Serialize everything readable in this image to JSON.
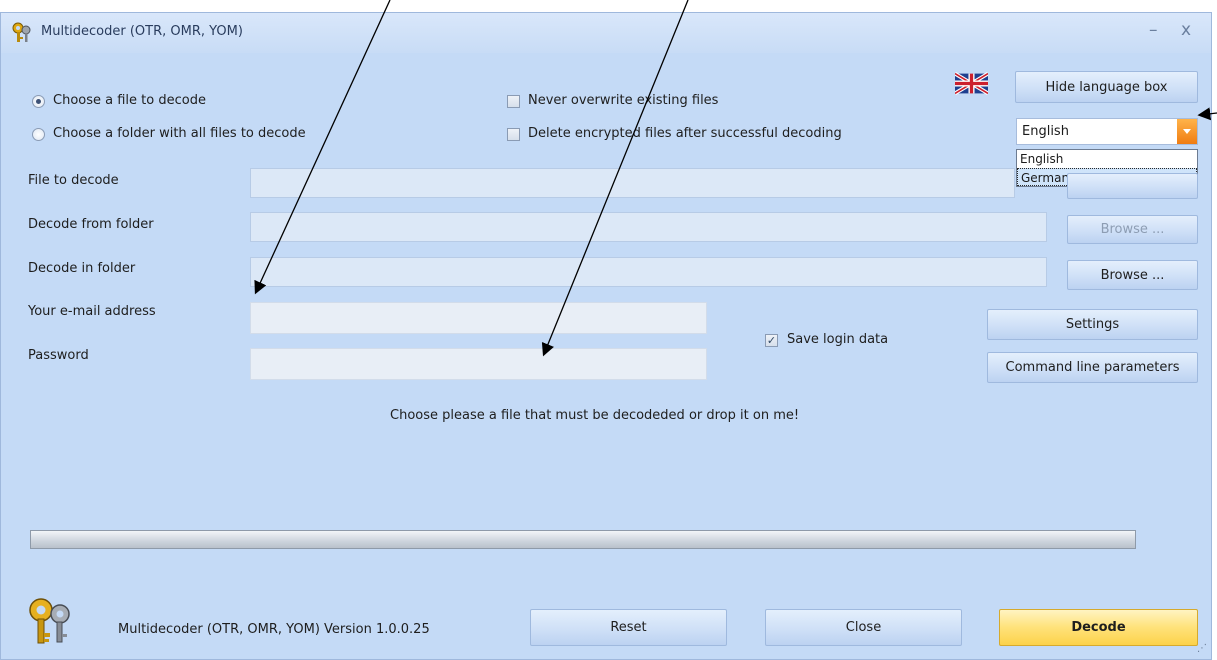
{
  "window": {
    "title": "Multidecoder (OTR, OMR, YOM)",
    "minimize": "–",
    "close": "x"
  },
  "mode": {
    "file_label": "Choose a file to decode",
    "folder_label": "Choose a folder with all files to decode",
    "selected": "file"
  },
  "options": {
    "never_overwrite_label": "Never overwrite existing files",
    "never_overwrite_checked": false,
    "delete_encrypted_label": "Delete encrypted files after successful decoding",
    "delete_encrypted_checked": false
  },
  "language": {
    "hide_button": "Hide language box",
    "selected": "English",
    "options": [
      "English",
      "German"
    ],
    "highlighted": "German",
    "flag_icon": "uk-flag-icon"
  },
  "fields": {
    "file_to_decode_label": "File to decode",
    "file_to_decode_value": "",
    "decode_from_label": "Decode from folder",
    "decode_from_value": "",
    "decode_in_label": "Decode in folder",
    "decode_in_value": "",
    "email_label": "Your e-mail address",
    "email_value": "",
    "password_label": "Password",
    "password_value": ""
  },
  "buttons": {
    "browse_from": "Browse ...",
    "browse_in": "Browse ...",
    "settings": "Settings",
    "command_line": "Command line parameters",
    "reset": "Reset",
    "close": "Close",
    "decode": "Decode"
  },
  "login": {
    "save_label": "Save login data",
    "save_checked": true
  },
  "status_message": "Choose please a file that must be decodeded or drop it on me!",
  "progress": {
    "value": 0
  },
  "footer": {
    "version_text": "Multidecoder (OTR, OMR, YOM)  Version 1.0.0.25",
    "logo_icon": "keys-icon"
  },
  "colors": {
    "window_bg": "#c4daf6",
    "decode_button": "#ffe27a",
    "combo_arrow": "#f07d12"
  }
}
